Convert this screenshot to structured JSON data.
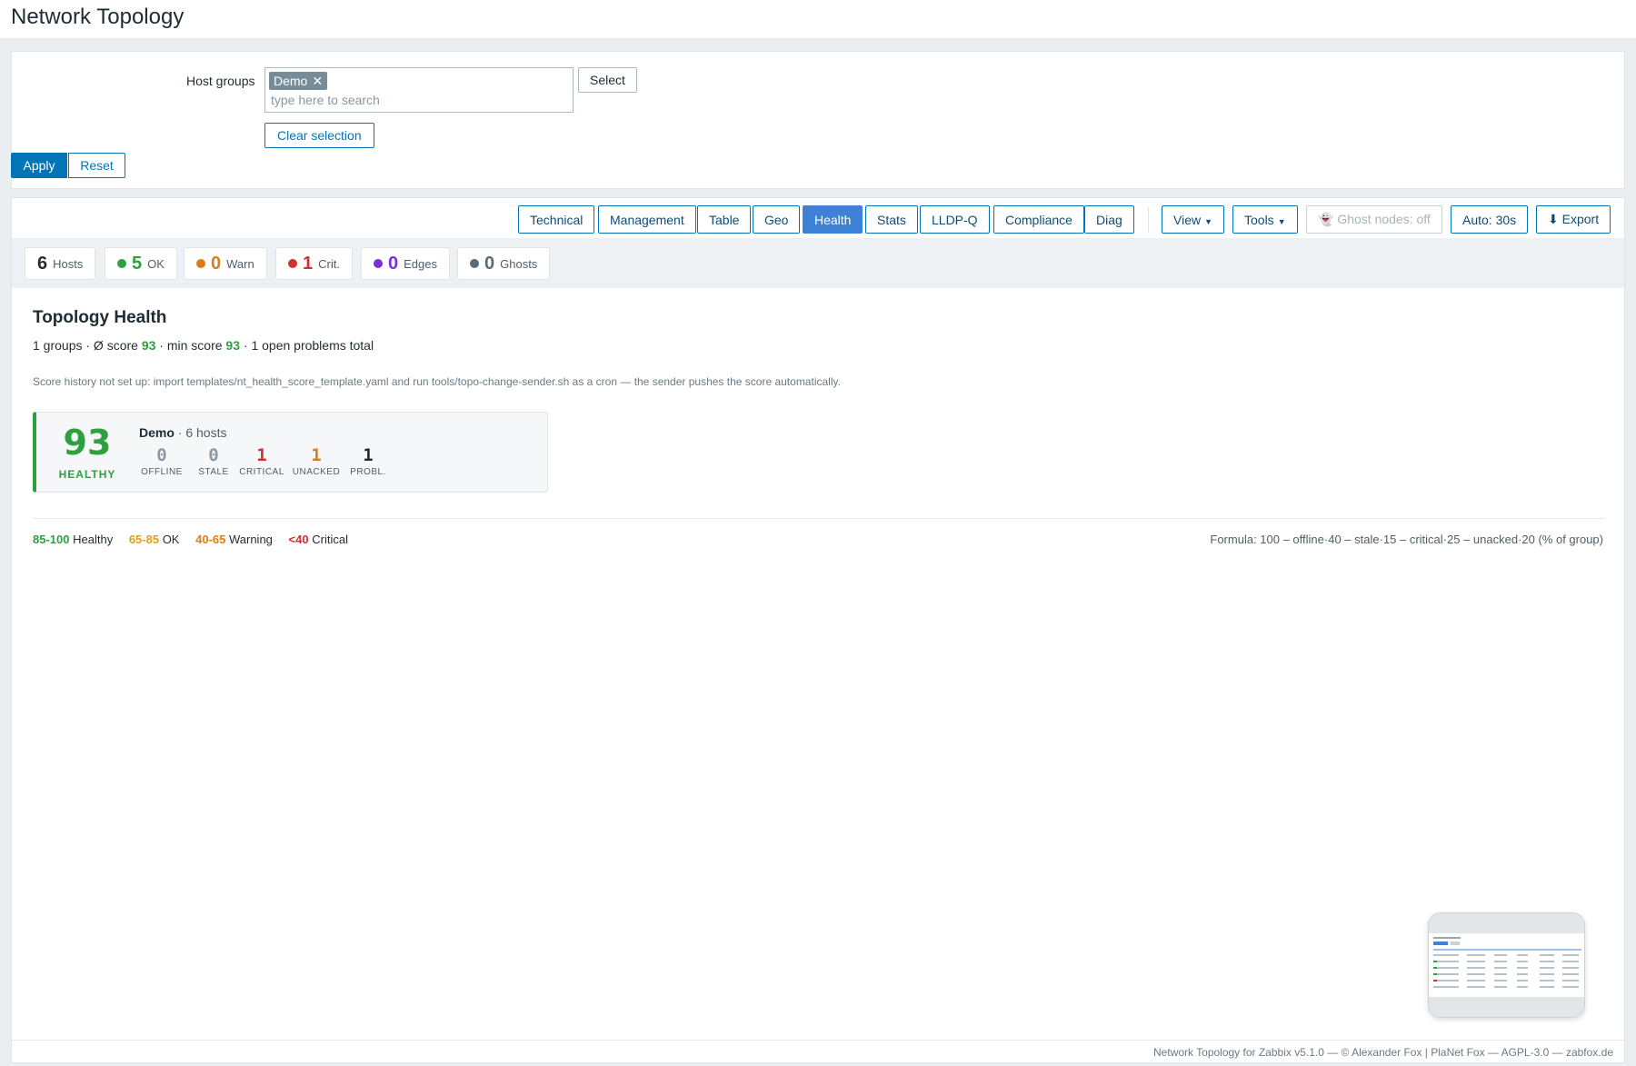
{
  "page": {
    "title": "Network Topology"
  },
  "filter": {
    "host_groups_label": "Host groups",
    "selected_chip": "Demo",
    "chip_remove": "✕",
    "search_placeholder": "type here to search",
    "select_label": "Select",
    "clear_selection_label": "Clear selection",
    "apply_label": "Apply",
    "reset_label": "Reset"
  },
  "toolbar": {
    "tabs": [
      {
        "label": "Technical"
      },
      {
        "label": "Management"
      },
      {
        "label": "Table"
      },
      {
        "label": "Geo"
      },
      {
        "label": "Health",
        "active": true
      },
      {
        "label": "Stats"
      },
      {
        "label": "LLDP-Q"
      },
      {
        "label": "Compliance"
      },
      {
        "label": "Diag"
      }
    ],
    "view_label": "View",
    "tools_label": "Tools",
    "ghost_label": "👻 Ghost nodes: off",
    "auto_label": "Auto: 30s",
    "export_label": "⬇ Export"
  },
  "stats": [
    {
      "value": "6",
      "label": "Hosts",
      "color": "#1f2c33",
      "dot": ""
    },
    {
      "value": "5",
      "label": "OK",
      "color": "#2f9f3f",
      "dot": "#2f9f3f"
    },
    {
      "value": "0",
      "label": "Warn",
      "color": "#e07b16",
      "dot": "#e07b16"
    },
    {
      "value": "1",
      "label": "Crit.",
      "color": "#d32f2f",
      "dot": "#d32f2f"
    },
    {
      "value": "0",
      "label": "Edges",
      "color": "#7b2fd6",
      "dot": "#7b2fd6"
    },
    {
      "value": "0",
      "label": "Ghosts",
      "color": "#5f6b73",
      "dot": "#5f6b73"
    }
  ],
  "health": {
    "title": "Topology Health",
    "summary_prefix": "1 groups · Ø score ",
    "avg_score": "93",
    "summary_mid": " · min score ",
    "min_score": "93",
    "summary_suffix": " · 1 open problems total",
    "note": "Score history not set up: import templates/nt_health_score_template.yaml and run tools/topo-change-sender.sh as a cron — the sender pushes the score automatically.",
    "group": {
      "score": "93",
      "status": "HEALTHY",
      "name": "Demo",
      "hosts": " · 6 hosts",
      "metrics": [
        {
          "value": "0",
          "label": "OFFLINE",
          "color": "#8a98a1"
        },
        {
          "value": "0",
          "label": "STALE",
          "color": "#8a98a1"
        },
        {
          "value": "1",
          "label": "CRITICAL",
          "color": "#d32f2f"
        },
        {
          "value": "1",
          "label": "UNACKED",
          "color": "#e07b16"
        },
        {
          "value": "1",
          "label": "PROBL.",
          "color": "#1f2c33"
        }
      ]
    },
    "legend": [
      {
        "range": "85-100",
        "label": "Healthy",
        "color": "#2f9f3f"
      },
      {
        "range": "65-85",
        "label": "OK",
        "color": "#e0a016"
      },
      {
        "range": "40-65",
        "label": "Warning",
        "color": "#e07b16"
      },
      {
        "range": "<40",
        "label": "Critical",
        "color": "#d32f2f"
      }
    ],
    "formula": "Formula: 100 – offline·40 – stale·15 – critical·25 – unacked·20 (% of group)"
  },
  "footer": "Network Topology for Zabbix v5.1.0 — © Alexander Fox | PlaNet Fox — AGPL-3.0 — zabfox.de"
}
